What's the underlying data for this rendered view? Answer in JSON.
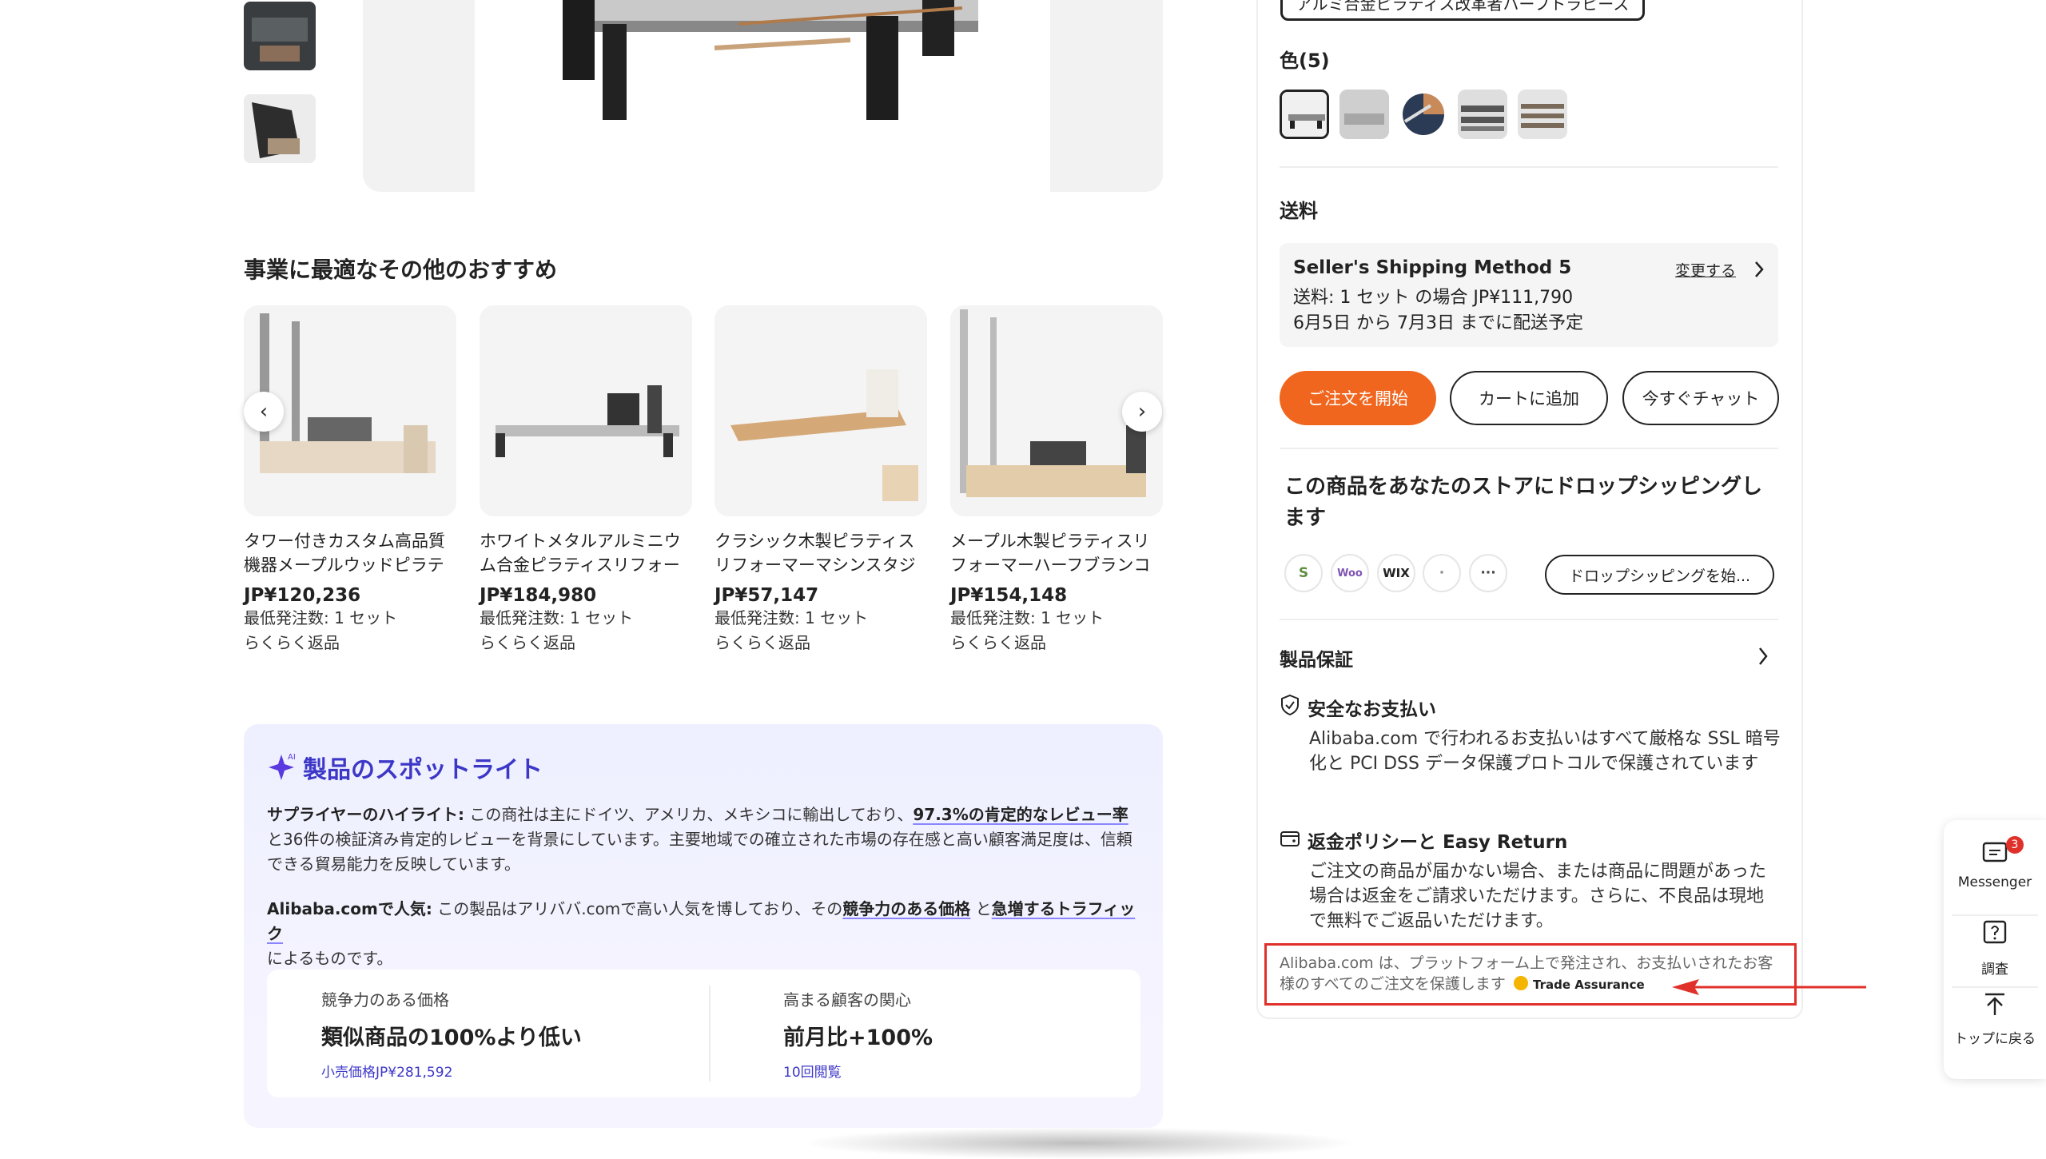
{
  "gallery": {
    "thumb_count": 2
  },
  "recommendations": {
    "title": "事業に最適なその他のおすすめ",
    "items": [
      {
        "name": "タワー付きカスタム高品質機器メープルウッドピラティ...",
        "price": "JP¥120,236",
        "moq": "最低発注数: 1 セット",
        "returns": "らくらく返品"
      },
      {
        "name": "ホワイトメタルアルミニウム合金ピラティスリフォーマ...",
        "price": "JP¥184,980",
        "moq": "最低発注数: 1 セット",
        "returns": "らくらく返品"
      },
      {
        "name": "クラシック木製ピラティスリフォーマーマシンスタジオ...",
        "price": "JP¥57,147",
        "moq": "最低発注数: 1 セット",
        "returns": "らくらく返品"
      },
      {
        "name": "メープル木製ピラティスリフォーマーハーフブランコヴ...",
        "price": "JP¥154,148",
        "moq": "最低発注数: 1 セット",
        "returns": "らくらく返品"
      }
    ],
    "prev": "‹",
    "next": "›"
  },
  "spotlight": {
    "title": "製品のスポットライト",
    "ai_tag": "AI",
    "supplier_label": "サプライヤーのハイライト:",
    "supplier_text1": " この商社は主にドイツ、アメリカ、メキシコに輸出しており、",
    "supplier_rate": "97.3%の肯定的なレビュー率",
    "supplier_text2": " と36件の検証済み肯定的レビューを背景にしています。主要地域での確立された市場の存在感と高い顧客満足度は、信頼できる貿易能力を反映しています。",
    "popular_label": "Alibaba.comで人気:",
    "popular_text1": " この製品はアリババ.comで高い人気を博しており、その",
    "popular_price": "競争力のある価格",
    "popular_and": " と",
    "popular_traffic": "急増するトラフィック",
    "popular_text2": "によるものです。",
    "stats": [
      {
        "label": "競争力のある価格",
        "value": "類似商品の100%より低い",
        "sub": "小売価格JP¥281,592"
      },
      {
        "label": "高まる顧客の関心",
        "value": "前月比+100%",
        "sub": "10回閲覧"
      }
    ]
  },
  "panel": {
    "variant": "アルミ合金ピラティス改革者ハーフトラピース",
    "color_label": "色(5)",
    "shipping_label": "送料",
    "shipping": {
      "method": "Seller's Shipping Method 5",
      "change": "変更する",
      "cost": "送料: 1 セット の場合 JP¥111,790",
      "delivery": "6月5日 から 7月3日 までに配送予定"
    },
    "buttons": {
      "order": "ご注文を開始",
      "cart": "カートに追加",
      "chat": "今すぐチャット"
    },
    "dropship": {
      "title": "この商品をあなたのストアにドロップシッピングします",
      "platforms": [
        "S",
        "Woo",
        "WIX",
        "·",
        "···"
      ],
      "button": "ドロップシッピングを始..."
    },
    "guarantee": {
      "title": "製品保証",
      "safe_title": "安全なお支払い",
      "safe_text": "Alibaba.com で行われるお支払いはすべて厳格な SSL 暗号化と PCI DSS データ保護プロトコルで保護されています",
      "refund_title": "返金ポリシーと Easy Return",
      "refund_text": "ご注文の商品が届かない場合、または商品に問題があった場合は返金をご請求いただけます。さらに、不良品は現地で無料でご返品いただけます。",
      "ta_text": "Alibaba.com は、プラットフォーム上で発注され、お支払いされたお客様のすべてのご注文を保護します",
      "ta_badge": "Trade Assurance"
    }
  },
  "side": {
    "messenger": "Messenger",
    "badge": "3",
    "survey": "調査",
    "top": "トップに戻る"
  },
  "colors": {
    "accent": "#f0661e",
    "spotlight": "#3d37c7",
    "annotation": "#e0302a"
  }
}
